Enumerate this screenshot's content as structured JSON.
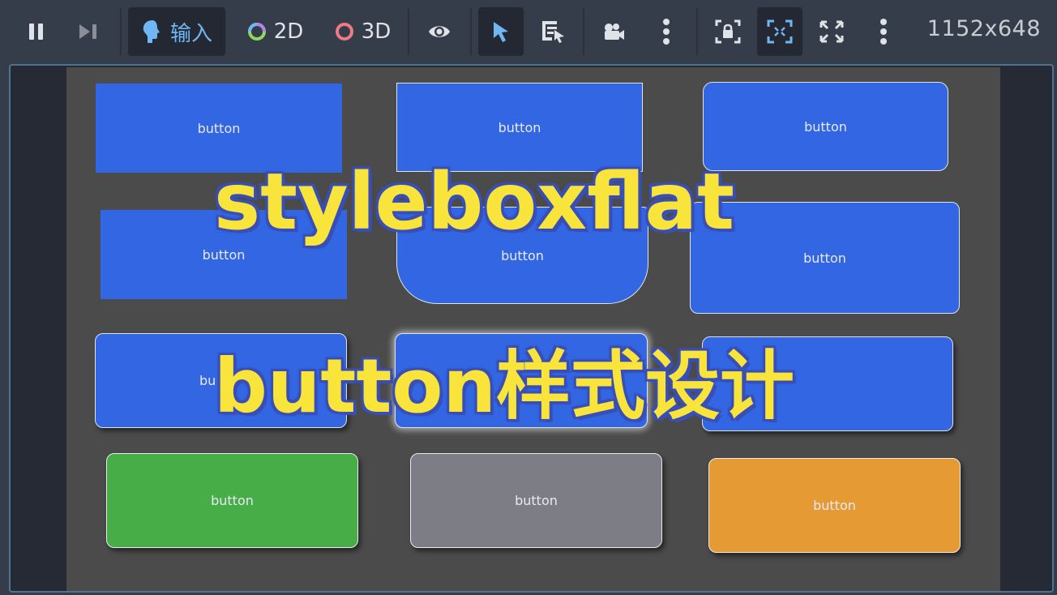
{
  "toolbar": {
    "pause_icon": "pause-icon",
    "step_icon": "step-forward-icon",
    "input_label": "输入",
    "mode_2d_label": "2D",
    "mode_3d_label": "3D",
    "resolution": "1152x648"
  },
  "canvas": {
    "buttons": [
      {
        "label": "button",
        "color": "#3266e2"
      },
      {
        "label": "button",
        "color": "#3266e2"
      },
      {
        "label": "button",
        "color": "#3266e2"
      },
      {
        "label": "button",
        "color": "#3266e2"
      },
      {
        "label": "button",
        "color": "#3266e2"
      },
      {
        "label": "button",
        "color": "#3266e2"
      },
      {
        "label": "bu",
        "color": "#3266e2"
      },
      {
        "label": "u",
        "color": "#3266e2"
      },
      {
        "label": "",
        "color": "#3266e2"
      },
      {
        "label": "button",
        "color": "#46ad47"
      },
      {
        "label": "button",
        "color": "#7d7d86"
      },
      {
        "label": "button",
        "color": "#e69a33"
      }
    ],
    "overlay_title_1": "styleboxflat",
    "overlay_title_2": "button样式设计"
  },
  "colors": {
    "accent_blue": "#6fb6f2",
    "button_blue": "#3266e2",
    "overlay_yellow": "#f8e43a",
    "overlay_outline": "#3a4fb7"
  }
}
